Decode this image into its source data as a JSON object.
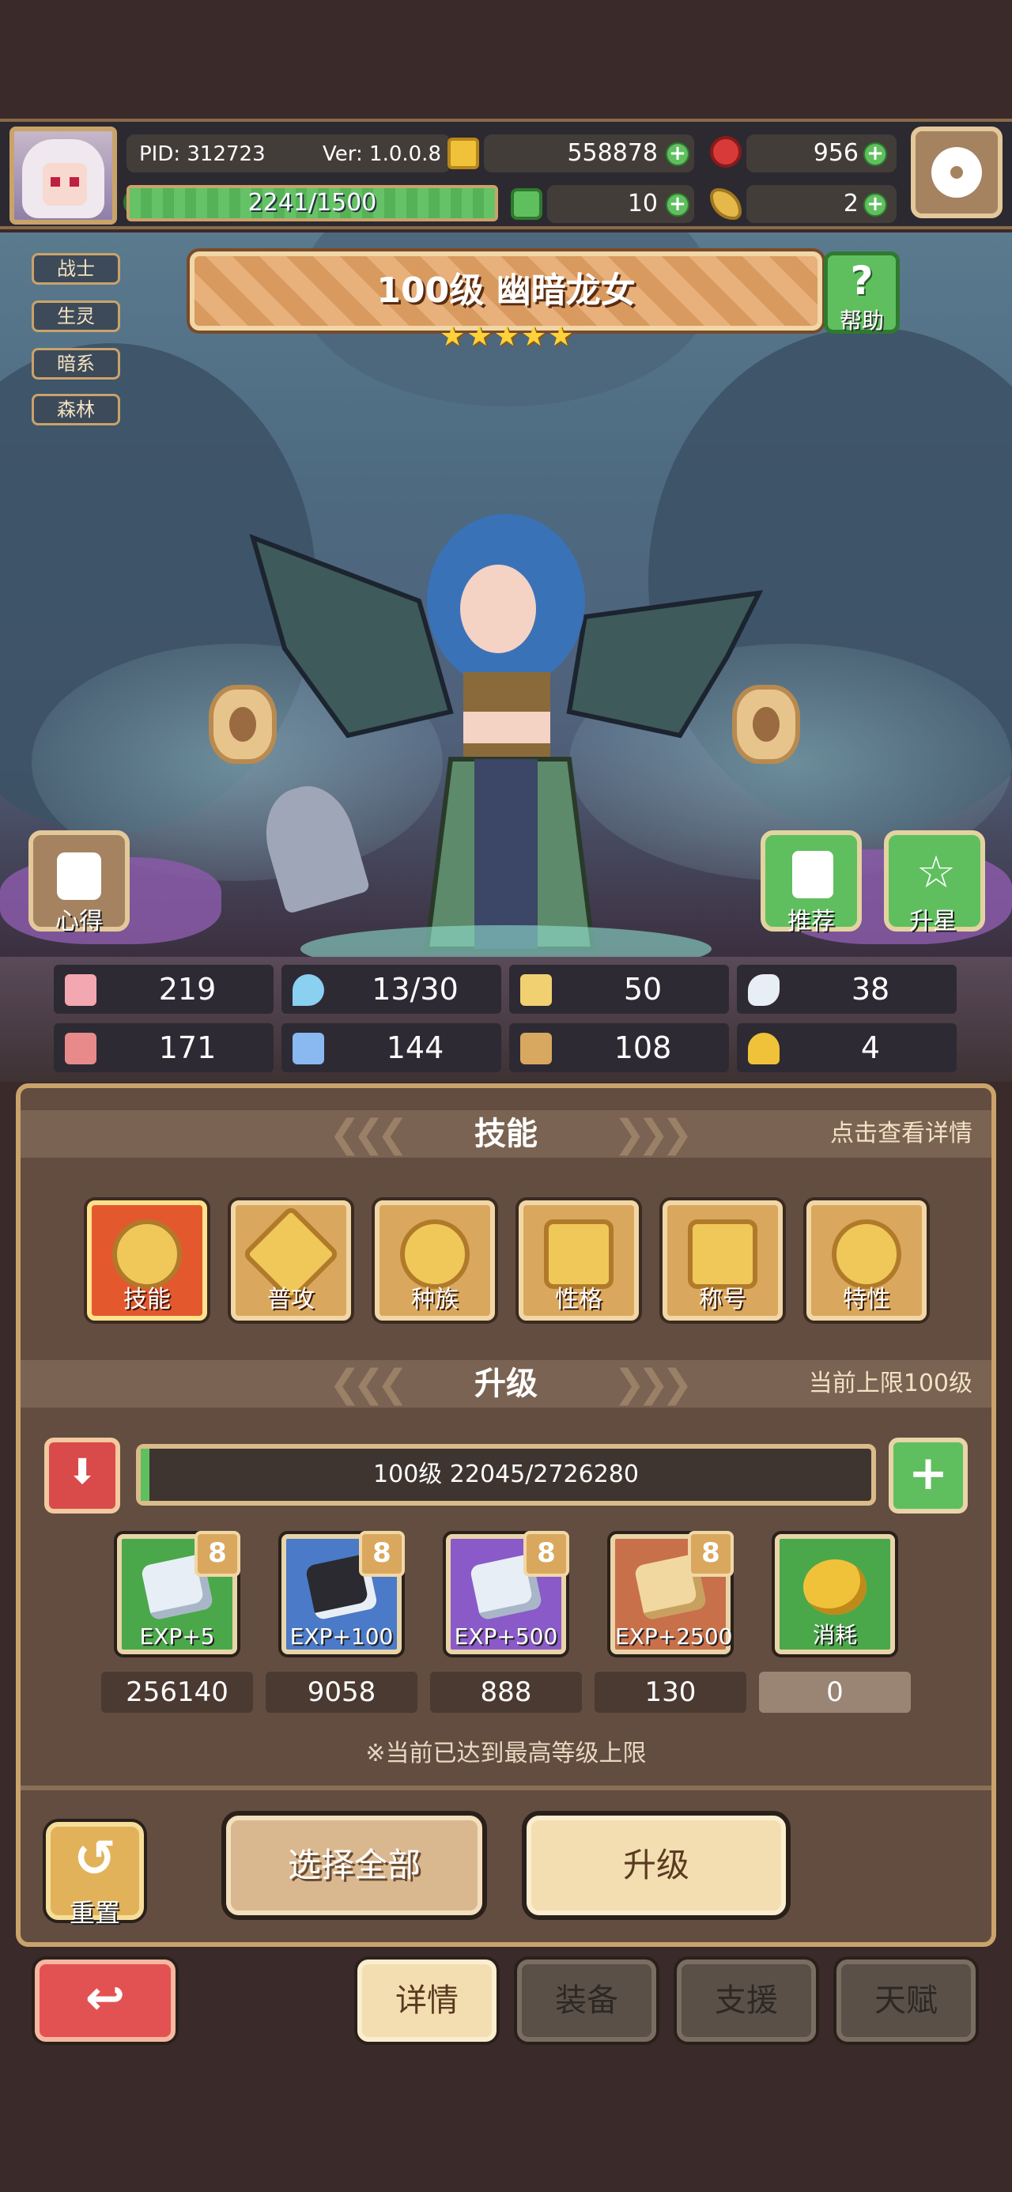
{
  "header": {
    "pid": "PID: 312723",
    "version": "Ver: 1.0.0.8",
    "gold": "558878",
    "gems": "956",
    "exp_bar": "2241/1500",
    "exp_progress": 1.0,
    "clover": "10",
    "fish": "2"
  },
  "tags": [
    "战士",
    "生灵",
    "暗系",
    "森林"
  ],
  "hero": {
    "title": "100级  幽暗龙女",
    "stars": 5,
    "help_label": "帮助",
    "left_button_label": "心得",
    "recommend_label": "推荐",
    "star_up_label": "升星"
  },
  "stats": [
    {
      "icon": "heart-icon",
      "value": "219"
    },
    {
      "icon": "water-drop-icon",
      "value": "13/30"
    },
    {
      "icon": "shield-icon",
      "value": "50"
    },
    {
      "icon": "wing-icon",
      "value": "38"
    },
    {
      "icon": "fist-icon",
      "value": "171"
    },
    {
      "icon": "book-icon",
      "value": "144"
    },
    {
      "icon": "stairs-icon",
      "value": "108"
    },
    {
      "icon": "horseshoe-icon",
      "value": "4"
    }
  ],
  "skills_section": {
    "title": "技能",
    "hint": "点击查看详情",
    "cards": [
      "技能",
      "普攻",
      "种族",
      "性格",
      "称号",
      "特性"
    ]
  },
  "upgrade_section": {
    "title": "升级",
    "hint": "当前上限100级",
    "level_text": "100级  22045/2726280",
    "level_progress": 0.008,
    "items": [
      {
        "label": "EXP+5",
        "count": "256140",
        "color": "#4aa84a"
      },
      {
        "label": "EXP+100",
        "count": "9058",
        "color": "#4a7ac8"
      },
      {
        "label": "EXP+500",
        "count": "888",
        "color": "#8a5ac8"
      },
      {
        "label": "EXP+2500",
        "count": "130",
        "color": "#c8704a"
      },
      {
        "label": "消耗",
        "count": "0",
        "color": "#4aa84a"
      }
    ],
    "max_note": "※当前已达到最高等级上限"
  },
  "actions": {
    "reset": "重置",
    "select_all": "选择全部",
    "upgrade": "升级"
  },
  "nav": {
    "tabs": [
      "详情",
      "装备",
      "支援",
      "天赋"
    ]
  }
}
